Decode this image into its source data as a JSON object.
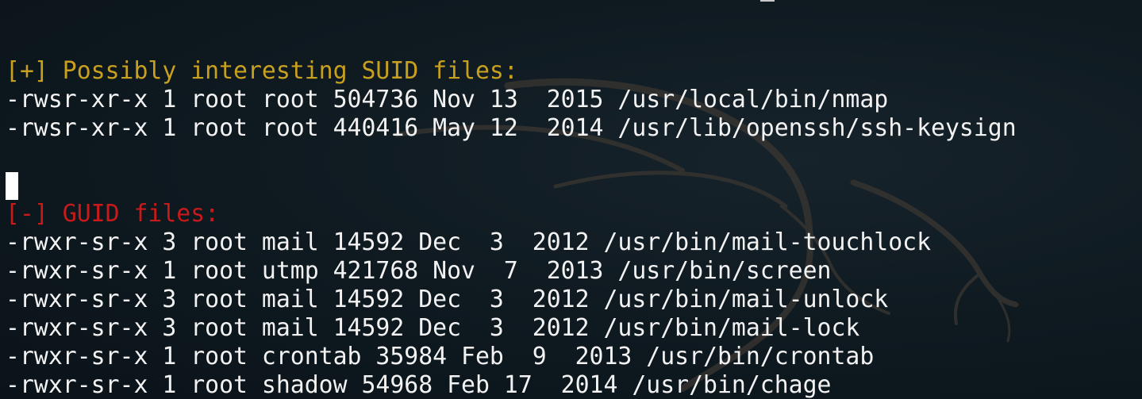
{
  "terminal": {
    "suid_header": "[+] Possibly interesting SUID files:",
    "suid_files": [
      "-rwsr-xr-x 1 root root 504736 Nov 13  2015 /usr/local/bin/nmap",
      "-rwsr-xr-x 1 root root 440416 May 12  2014 /usr/lib/openssh/ssh-keysign"
    ],
    "guid_header": "[-] GUID files:",
    "guid_files": [
      "-rwxr-sr-x 3 root mail 14592 Dec  3  2012 /usr/bin/mail-touchlock",
      "-rwxr-sr-x 1 root utmp 421768 Nov  7  2013 /usr/bin/screen",
      "-rwxr-sr-x 3 root mail 14592 Dec  3  2012 /usr/bin/mail-unlock",
      "-rwxr-sr-x 3 root mail 14592 Dec  3  2012 /usr/bin/mail-lock",
      "-rwxr-sr-x 1 root crontab 35984 Feb  9  2013 /usr/bin/crontab",
      "-rwxr-sr-x 1 root shadow 54968 Feb 17  2014 /usr/bin/chage"
    ]
  },
  "colors": {
    "background": "#0f1a21",
    "text": "#f2f2f2",
    "suid_header": "#c8a020",
    "guid_header": "#c81a1a",
    "cursor": "#ffffff"
  }
}
